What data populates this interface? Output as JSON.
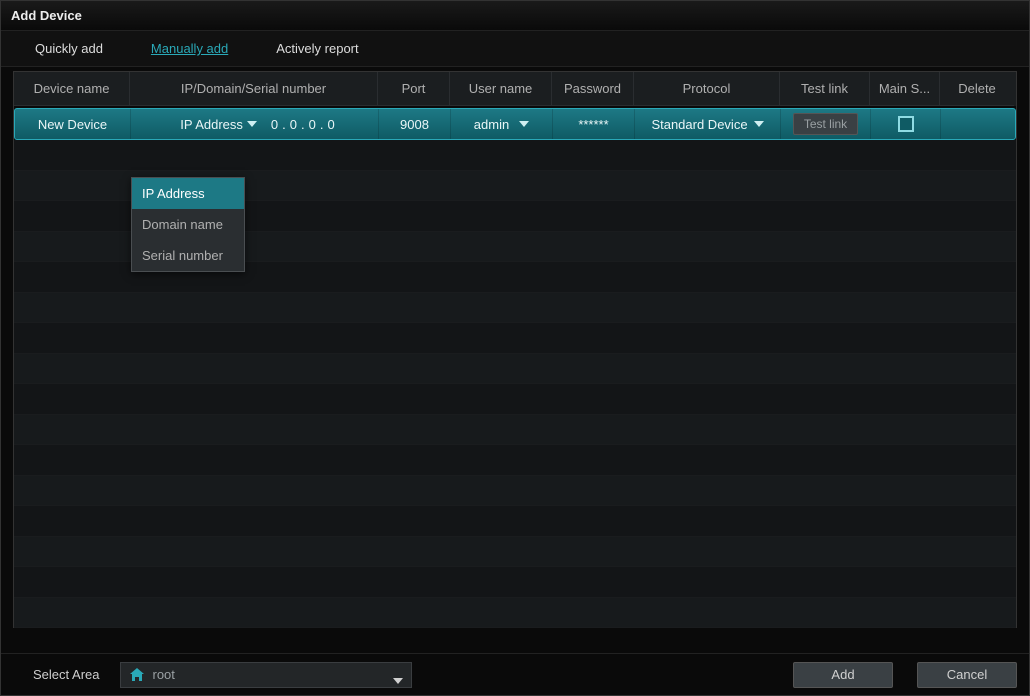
{
  "window": {
    "title": "Add Device"
  },
  "tabs": [
    {
      "label": "Quickly add",
      "active": false
    },
    {
      "label": "Manually add",
      "active": true
    },
    {
      "label": "Actively report",
      "active": false
    }
  ],
  "columns": {
    "name": "Device name",
    "ip": "IP/Domain/Serial number",
    "port": "Port",
    "user": "User name",
    "pass": "Password",
    "proto": "Protocol",
    "test": "Test link",
    "main": "Main S...",
    "del": "Delete"
  },
  "row": {
    "name": "New Device",
    "ip_type": "IP Address",
    "ip": [
      "0",
      "0",
      "0",
      "0"
    ],
    "port": "9008",
    "user": "admin",
    "pass": "******",
    "proto": "Standard Device",
    "test_btn": "Test link",
    "main_checked": false
  },
  "ip_type_options": [
    "IP Address",
    "Domain name",
    "Serial number"
  ],
  "footer": {
    "select_area_label": "Select Area",
    "area_value": "root",
    "add": "Add",
    "cancel": "Cancel"
  }
}
